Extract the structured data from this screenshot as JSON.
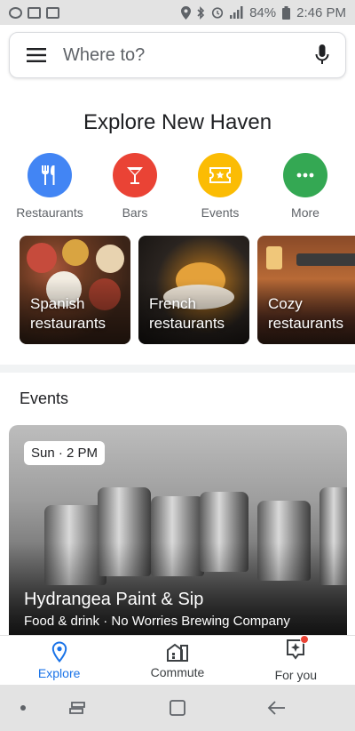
{
  "status_bar": {
    "battery": "84%",
    "time": "2:46 PM"
  },
  "search": {
    "placeholder": "Where to?"
  },
  "explore": {
    "title": "Explore New Haven"
  },
  "categories": [
    {
      "label": "Restaurants",
      "icon": "fork-knife-icon",
      "color": "#4285f4"
    },
    {
      "label": "Bars",
      "icon": "cocktail-icon",
      "color": "#ea4335"
    },
    {
      "label": "Events",
      "icon": "ticket-icon",
      "color": "#fbbc04"
    },
    {
      "label": "More",
      "icon": "more-dots-icon",
      "color": "#34a853"
    }
  ],
  "cards": [
    {
      "title": "Spanish restaurants"
    },
    {
      "title": "French restaurants"
    },
    {
      "title": "Cozy restaurants"
    }
  ],
  "events": {
    "heading": "Events",
    "featured": {
      "time": "Sun · 2 PM",
      "name": "Hydrangea Paint & Sip",
      "meta": "Food & drink · No Worries Brewing Company"
    }
  },
  "bottom_nav": [
    {
      "label": "Explore",
      "icon": "location-pin-icon",
      "active": true
    },
    {
      "label": "Commute",
      "icon": "commute-building-icon",
      "active": false
    },
    {
      "label": "For you",
      "icon": "sparkle-badge-icon",
      "active": false
    }
  ],
  "colors": {
    "accent": "#1a73e8",
    "badge": "#ea4335"
  }
}
